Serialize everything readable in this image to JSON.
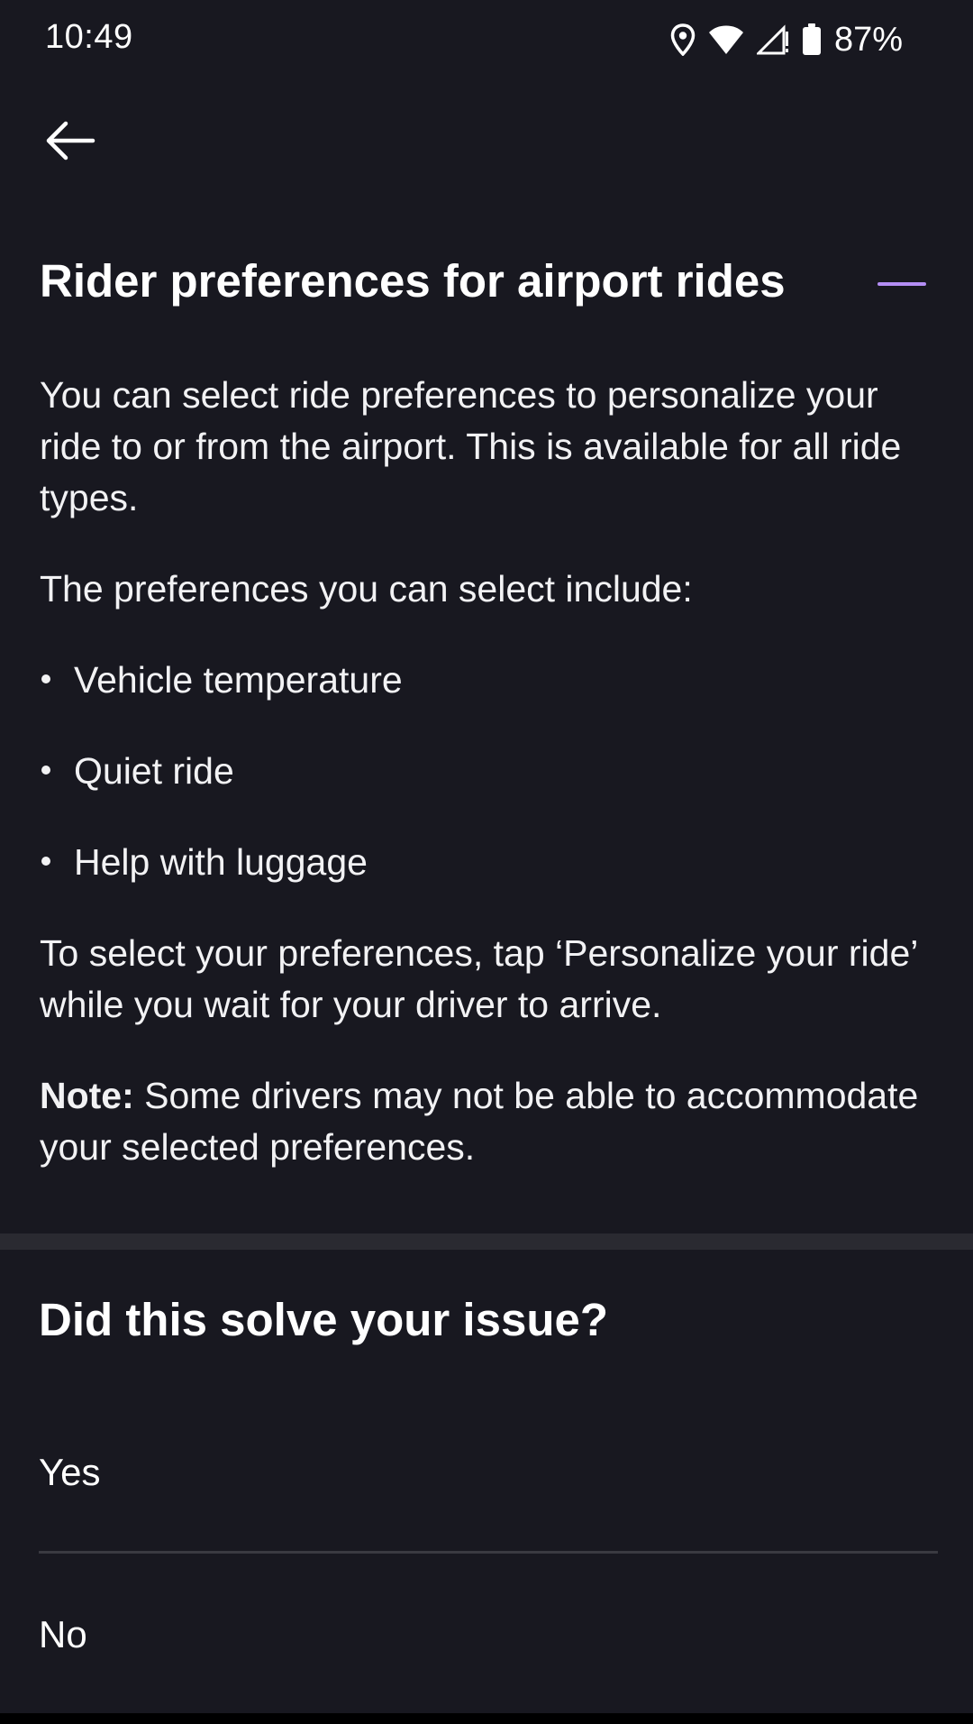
{
  "status_bar": {
    "time": "10:49",
    "battery_percent": "87%",
    "icons": [
      "location-icon",
      "wifi-icon",
      "cellular-signal-icon",
      "battery-icon"
    ]
  },
  "nav": {
    "back_icon": "arrow-left-icon"
  },
  "article": {
    "title": "Rider preferences for airport rides",
    "collapse_icon": "minus-icon",
    "accent_color": "#b48ef5",
    "intro": "You can select ride preferences to personalize your ride to or from the airport. This is available for all ride types.",
    "list_intro": "The preferences you can select include:",
    "preferences": [
      "Vehicle temperature",
      "Quiet ride",
      "Help with luggage"
    ],
    "instructions": "To select your preferences, tap ‘Personalize your ride’ while you wait for your driver to arrive.",
    "note_label": "Note:",
    "note_text": " Some drivers may not be able to accommodate your selected preferences."
  },
  "feedback": {
    "question": "Did this solve your issue?",
    "yes_label": "Yes",
    "no_label": "No"
  },
  "colors": {
    "background": "#181820",
    "divider": "#2a2a31"
  }
}
